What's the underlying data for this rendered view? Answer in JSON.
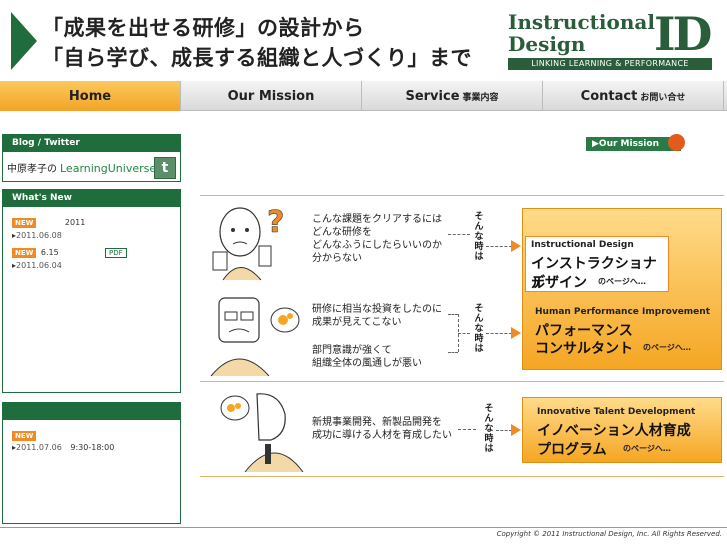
{
  "header": {
    "tagline_1": "「成果を出せる研修」の設計から",
    "tagline_2": "「自ら学び、成長する組織と人づくり」まで",
    "logo_line1": "Instructional",
    "logo_line2": "Design",
    "logo_mark": "ID",
    "logo_bar": "LINKING LEARNING & PERFORMANCE"
  },
  "nav": {
    "items": [
      {
        "label": "Home",
        "sub": ""
      },
      {
        "label": "Our Mission",
        "sub": ""
      },
      {
        "label": "Service",
        "sub": "事業内容"
      },
      {
        "label": "Contact",
        "sub": "お問い合せ"
      }
    ]
  },
  "sidebar": {
    "blog": {
      "title": "Blog / Twitter",
      "author": "中原孝子の",
      "blog_name": "LearningUniverse",
      "twitter_icon": "t"
    },
    "whats_new": {
      "title": "What's New",
      "entries": [
        {
          "badge": "NEW",
          "text": "2011",
          "date": "2011.06.08"
        },
        {
          "badge": "NEW",
          "text": "6.15",
          "date": "2011.06.04",
          "pdf": "PDF"
        }
      ]
    },
    "events": {
      "title": "",
      "entries": [
        {
          "badge": "NEW",
          "date": "2011.07.06",
          "time": "9:30-18:00"
        }
      ]
    }
  },
  "main": {
    "mission_button": "Our Mission",
    "rows": [
      {
        "questions": [
          "こんな課題をクリアするには",
          "どんな研修を",
          "どんなふうにしたらいいのか",
          "分からない"
        ],
        "when_label": "そんな時は",
        "en_title": "Instructional Design",
        "jp_title_1": "インストラクショナル",
        "jp_title_2": "デザイン",
        "link": "のページへ…"
      },
      {
        "questions": [
          "研修に相当な投資をしたのに",
          "成果が見えてこない"
        ],
        "questions_2": [
          "部門意識が強くて",
          "組織全体の風通しが悪い"
        ],
        "when_label": "そんな時は",
        "en_title": "Human Performance Improvement",
        "jp_title_1": "パフォーマンス",
        "jp_title_2": "コンサルタント",
        "link": "のページへ…"
      },
      {
        "questions": [
          "新規事業開発、新製品開発を",
          "成功に導ける人材を育成したい"
        ],
        "when_label": "そんな時は",
        "en_title": "Innovative Talent Development",
        "jp_title_1": "イノベーション人材育成",
        "jp_title_2": "プログラム",
        "link": "のページへ…"
      }
    ]
  },
  "footer": {
    "copyright": "Copyright © 2011 Instructional Design, Inc. All Rights Reserved."
  },
  "colors": {
    "brand_green": "#1f6d3d",
    "accent_orange": "#f08a24",
    "nav_active": "#f5b240"
  }
}
